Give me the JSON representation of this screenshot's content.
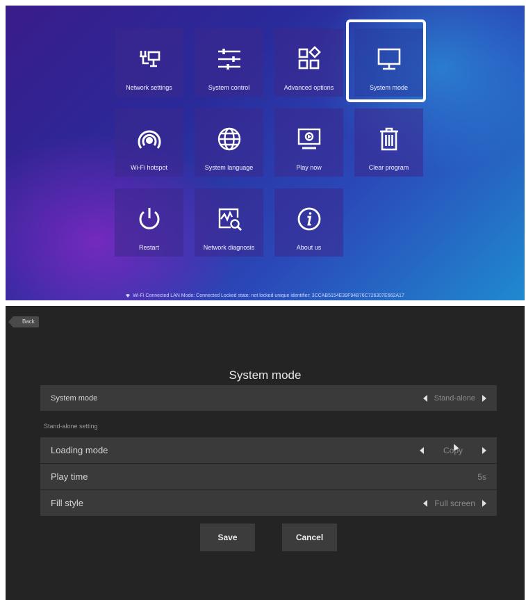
{
  "launcher": {
    "tiles": [
      {
        "label": "Network settings",
        "icon": "network-settings-icon"
      },
      {
        "label": "System control",
        "icon": "sliders-icon"
      },
      {
        "label": "Advanced options",
        "icon": "widgets-icon"
      },
      {
        "label": "System mode",
        "icon": "monitor-icon"
      },
      {
        "label": "Wi-Fi hotspot",
        "icon": "hotspot-icon"
      },
      {
        "label": "System language",
        "icon": "globe-icon"
      },
      {
        "label": "Play now",
        "icon": "play-screen-icon"
      },
      {
        "label": "Clear program",
        "icon": "trash-icon"
      },
      {
        "label": "Restart",
        "icon": "power-icon"
      },
      {
        "label": "Network diagnosis",
        "icon": "diagnosis-icon"
      },
      {
        "label": "About us",
        "icon": "info-icon"
      }
    ],
    "status": "Wi-Fi Connected  LAN Mode: Connected  Locked state: not locked  unique identifier: 3CCAB5154E39F94B76C726307E662A17"
  },
  "settings": {
    "back_label": "Back",
    "title": "System mode",
    "system_mode": {
      "label": "System mode",
      "value": "Stand-alone"
    },
    "section_label": "Stand-alone setting",
    "loading_mode": {
      "label": "Loading mode",
      "value": "Copy"
    },
    "play_time": {
      "label": "Play time",
      "value": "5s"
    },
    "fill_style": {
      "label": "Fill style",
      "value": "Full screen"
    },
    "save_label": "Save",
    "cancel_label": "Cancel"
  }
}
